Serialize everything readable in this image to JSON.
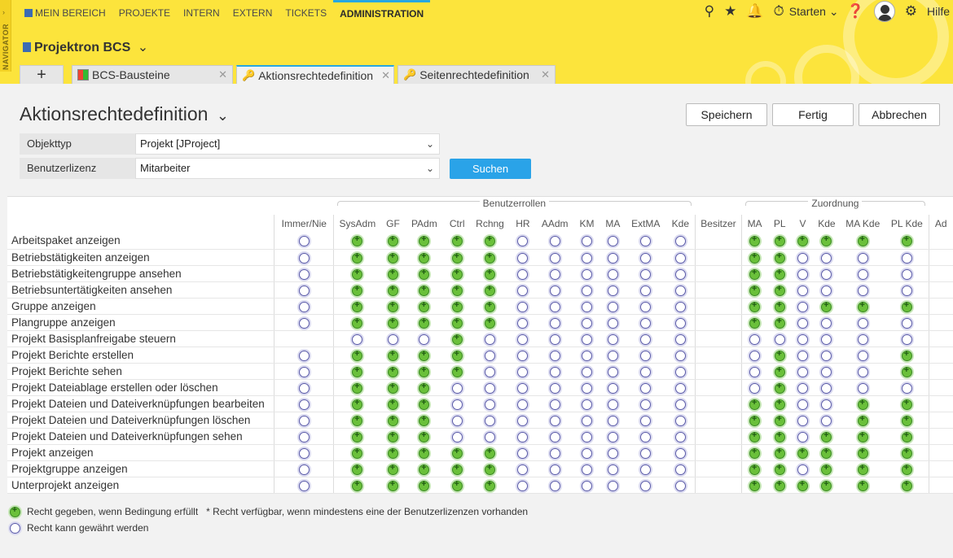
{
  "nav": {
    "navigator_label": "NAVIGATOR",
    "items": [
      "MEIN BEREICH",
      "PROJEKTE",
      "INTERN",
      "EXTERN",
      "TICKETS",
      "ADMINISTRATION"
    ],
    "starten_label": "Starten",
    "hilfe_label": "Hilfe"
  },
  "project": {
    "title": "Projektron BCS"
  },
  "tabs": [
    {
      "label": "BCS-Bausteine",
      "icon": "modules-icon"
    },
    {
      "label": "Aktionsrechtedefinition",
      "icon": "key-icon"
    },
    {
      "label": "Seitenrechtedefinition",
      "icon": "key-icon"
    }
  ],
  "page": {
    "title": "Aktionsrechtedefinition",
    "buttons": {
      "save": "Speichern",
      "done": "Fertig",
      "cancel": "Abbrechen"
    }
  },
  "filters": {
    "objekttyp_label": "Objekttyp",
    "objekttyp_value": "Projekt [JProject]",
    "lizenz_label": "Benutzerlizenz",
    "lizenz_value": "Mitarbeiter",
    "search_button": "Suchen"
  },
  "table": {
    "group_benutzerrollen": "Benutzerrollen",
    "group_zuordnung": "Zuordnung",
    "columns": [
      "Immer/Nie",
      "SysAdm",
      "GF",
      "PAdm",
      "Ctrl",
      "Rchng",
      "HR",
      "AAdm",
      "KM",
      "MA",
      "ExtMA",
      "Kde",
      "Besitzer",
      "MA",
      "PL",
      "V",
      "Kde",
      "MA Kde",
      "PL Kde",
      "Ad"
    ],
    "rows": [
      {
        "label": "Arbeitspaket anzeigen",
        "cells": "o g g g g g o o o o o o - g g g g g g"
      },
      {
        "label": "Betriebstätigkeiten anzeigen",
        "cells": "o g g g g g o o o o o o - g g o o o o"
      },
      {
        "label": "Betriebstätigkeitengruppe ansehen",
        "cells": "o g g g g g o o o o o o - g g o o o o"
      },
      {
        "label": "Betriebsuntertätigkeiten ansehen",
        "cells": "o g g g g g o o o o o o - g g o o o o"
      },
      {
        "label": "Gruppe anzeigen",
        "cells": "o g g g g g o o o o o o - g g o g g g"
      },
      {
        "label": "Plangruppe anzeigen",
        "cells": "o g g g g g o o o o o o - g g o o o o"
      },
      {
        "label": "Projekt Basisplanfreigabe steuern",
        "cells": "- o o o g o o o o o o o - o o o o o o"
      },
      {
        "label": "Projekt Berichte erstellen",
        "cells": "o g g g g o o o o o o o - o g o o o g"
      },
      {
        "label": "Projekt Berichte sehen",
        "cells": "o g g g g o o o o o o o - o g o o o g"
      },
      {
        "label": "Projekt Dateiablage erstellen oder löschen",
        "cells": "o g g g o o o o o o o o - o g o o o o"
      },
      {
        "label": "Projekt Dateien und Dateiverknüpfungen bearbeiten",
        "cells": "o g g g o o o o o o o o - g g o o g g"
      },
      {
        "label": "Projekt Dateien und Dateiverknüpfungen löschen",
        "cells": "o g g g o o o o o o o o - g g o o g g"
      },
      {
        "label": "Projekt Dateien und Dateiverknüpfungen sehen",
        "cells": "o g g g o o o o o o o o - g g o g g g"
      },
      {
        "label": "Projekt anzeigen",
        "cells": "o g g g g g o o o o o o - g g g g g g"
      },
      {
        "label": "Projektgruppe anzeigen",
        "cells": "o g g g g g o o o o o o - g g o g g g"
      },
      {
        "label": "Unterprojekt anzeigen",
        "cells": "o g g g g g o o o o o o - g g g g g g"
      }
    ]
  },
  "legend": {
    "granted": "Recht gegeben, wenn Bedingung erfüllt",
    "star": "* Recht verfügbar, wenn mindestens eine der Benutzerlizenzen vorhanden",
    "grantable": "Recht kann gewährt werden"
  },
  "colors": {
    "header_bg": "#fce43c",
    "accent": "#2aa3e8",
    "granted": "#6ac03a"
  }
}
